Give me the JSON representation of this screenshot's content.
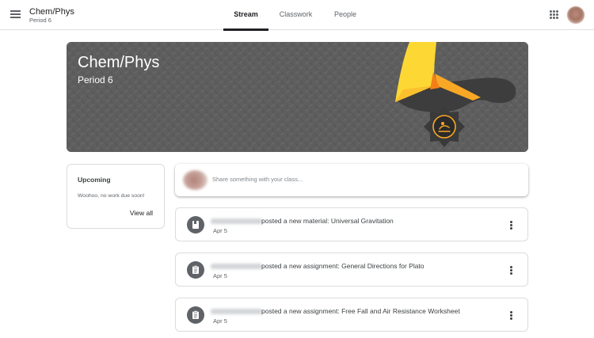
{
  "header": {
    "class_name": "Chem/Phys",
    "section": "Period 6",
    "tabs": [
      {
        "label": "Stream",
        "active": true
      },
      {
        "label": "Classwork",
        "active": false
      },
      {
        "label": "People",
        "active": false
      }
    ],
    "icons": {
      "menu": "hamburger-menu-icon",
      "apps": "google-apps-icon",
      "account": "account-avatar"
    }
  },
  "banner": {
    "title": "Chem/Phys",
    "subtitle": "Period 6",
    "colors": {
      "background": "#5f5f5f",
      "accent_yellow": "#fdd835",
      "accent_orange": "#f9a825"
    }
  },
  "upcoming": {
    "title": "Upcoming",
    "empty_message": "Woohoo, no work due soon!",
    "view_all_label": "View all"
  },
  "share": {
    "placeholder": "Share something with your class..."
  },
  "posts": [
    {
      "type": "material",
      "icon": "material-icon",
      "text": "posted a new material: Universal Gravitation",
      "date": "Apr 5"
    },
    {
      "type": "assignment",
      "icon": "assignment-icon",
      "text": "posted a new assignment: General Directions for Plato",
      "date": "Apr 5"
    },
    {
      "type": "assignment",
      "icon": "assignment-icon",
      "text": "posted a new assignment: Free Fall and Air Resistance Worksheet",
      "date": "Apr 5"
    }
  ]
}
